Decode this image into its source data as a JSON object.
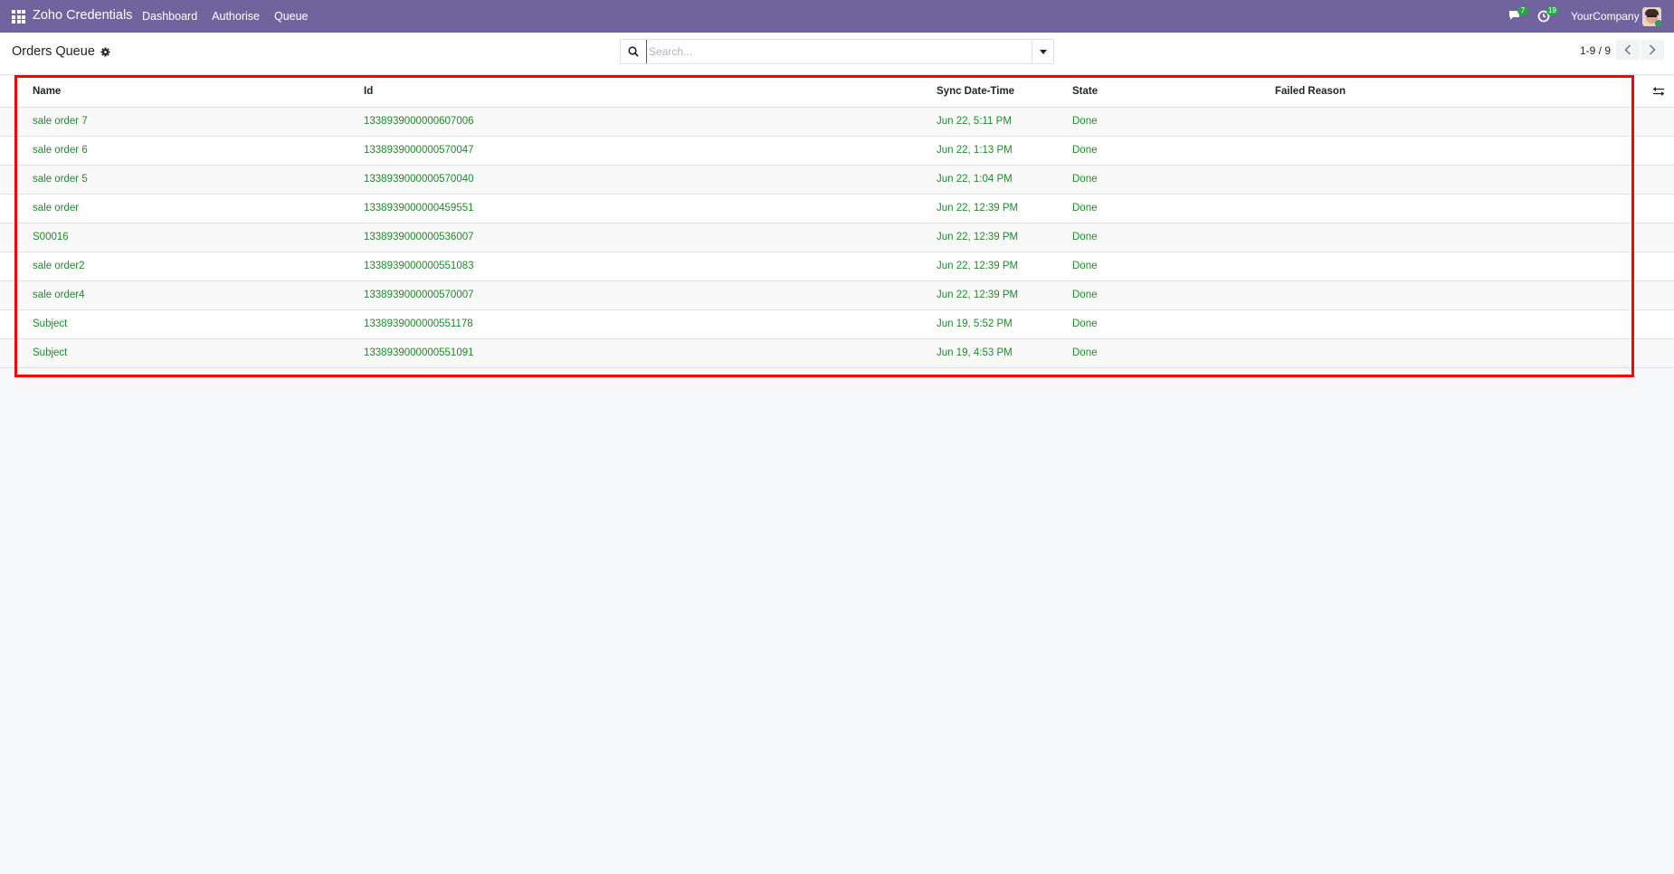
{
  "navbar": {
    "app_name": "Zoho Credentials",
    "menu": [
      "Dashboard",
      "Authorise",
      "Queue"
    ],
    "messages_count": "7",
    "activities_count": "19",
    "company": "YourCompany",
    "color": "#71639e"
  },
  "control_panel": {
    "title": "Orders Queue",
    "search_placeholder": "Search...",
    "pager": "1-9 / 9"
  },
  "table": {
    "columns": [
      "Name",
      "Id",
      "Sync Date-Time",
      "State",
      "Failed Reason"
    ],
    "rows": [
      {
        "name": "sale order 7",
        "id": "1338939000000607006",
        "sync": "Jun 22, 5:11 PM",
        "state": "Done",
        "reason": ""
      },
      {
        "name": "sale order 6",
        "id": "1338939000000570047",
        "sync": "Jun 22, 1:13 PM",
        "state": "Done",
        "reason": ""
      },
      {
        "name": "sale order 5",
        "id": "1338939000000570040",
        "sync": "Jun 22, 1:04 PM",
        "state": "Done",
        "reason": ""
      },
      {
        "name": "sale order",
        "id": "1338939000000459551",
        "sync": "Jun 22, 12:39 PM",
        "state": "Done",
        "reason": ""
      },
      {
        "name": "S00016",
        "id": "1338939000000536007",
        "sync": "Jun 22, 12:39 PM",
        "state": "Done",
        "reason": ""
      },
      {
        "name": "sale order2",
        "id": "1338939000000551083",
        "sync": "Jun 22, 12:39 PM",
        "state": "Done",
        "reason": ""
      },
      {
        "name": "sale order4",
        "id": "1338939000000570007",
        "sync": "Jun 22, 12:39 PM",
        "state": "Done",
        "reason": ""
      },
      {
        "name": "Subject",
        "id": "1338939000000551178",
        "sync": "Jun 19, 5:52 PM",
        "state": "Done",
        "reason": ""
      },
      {
        "name": "Subject",
        "id": "1338939000000551091",
        "sync": "Jun 19, 4:53 PM",
        "state": "Done",
        "reason": ""
      }
    ],
    "row_text_color": "#1e8a2a",
    "highlight_color": "#ff0000"
  }
}
